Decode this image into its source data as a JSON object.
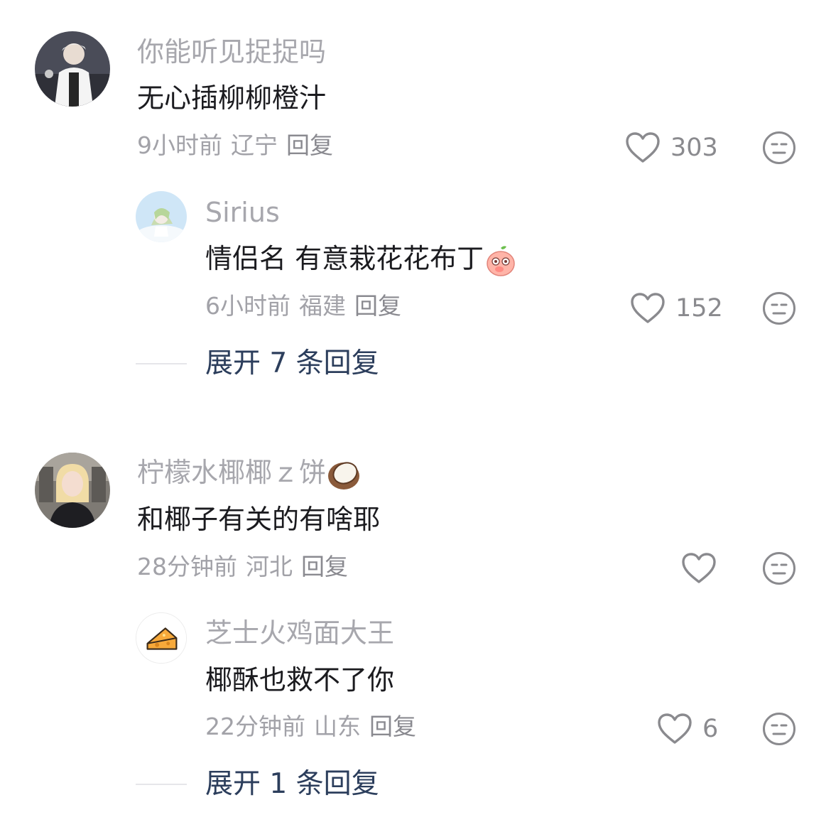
{
  "threads": [
    {
      "comment": {
        "username": "你能听见捉捉吗",
        "text": "无心插柳柳橙汁",
        "time": "9小时前",
        "location": "辽宁",
        "reply_label": "回复",
        "likes": "303"
      },
      "reply": {
        "username": "Sirius",
        "text": "情侣名 有意栽花花布丁",
        "time": "6小时前",
        "location": "福建",
        "reply_label": "回复",
        "likes": "152"
      },
      "expand_label": "展开 7 条回复"
    },
    {
      "comment": {
        "username": "柠檬水椰椰ｚ饼",
        "text": "和椰子有关的有啥耶",
        "time": "28分钟前",
        "location": "河北",
        "reply_label": "回复",
        "likes": ""
      },
      "reply": {
        "username": "芝士火鸡面大王",
        "text": "椰酥也救不了你",
        "time": "22分钟前",
        "location": "山东",
        "reply_label": "回复",
        "likes": "6"
      },
      "expand_label": "展开 1 条回复"
    }
  ],
  "icons": {
    "like": "heart-outline-icon",
    "dislike": "neutral-face-icon",
    "reply_emoji": "peach-face-emoji",
    "name_emoji": "coconut-emoji"
  },
  "colors": {
    "username": "#a7a7ad",
    "text": "#1b1b1f",
    "meta": "#a2a2a8",
    "expand": "#2c3e5c"
  }
}
